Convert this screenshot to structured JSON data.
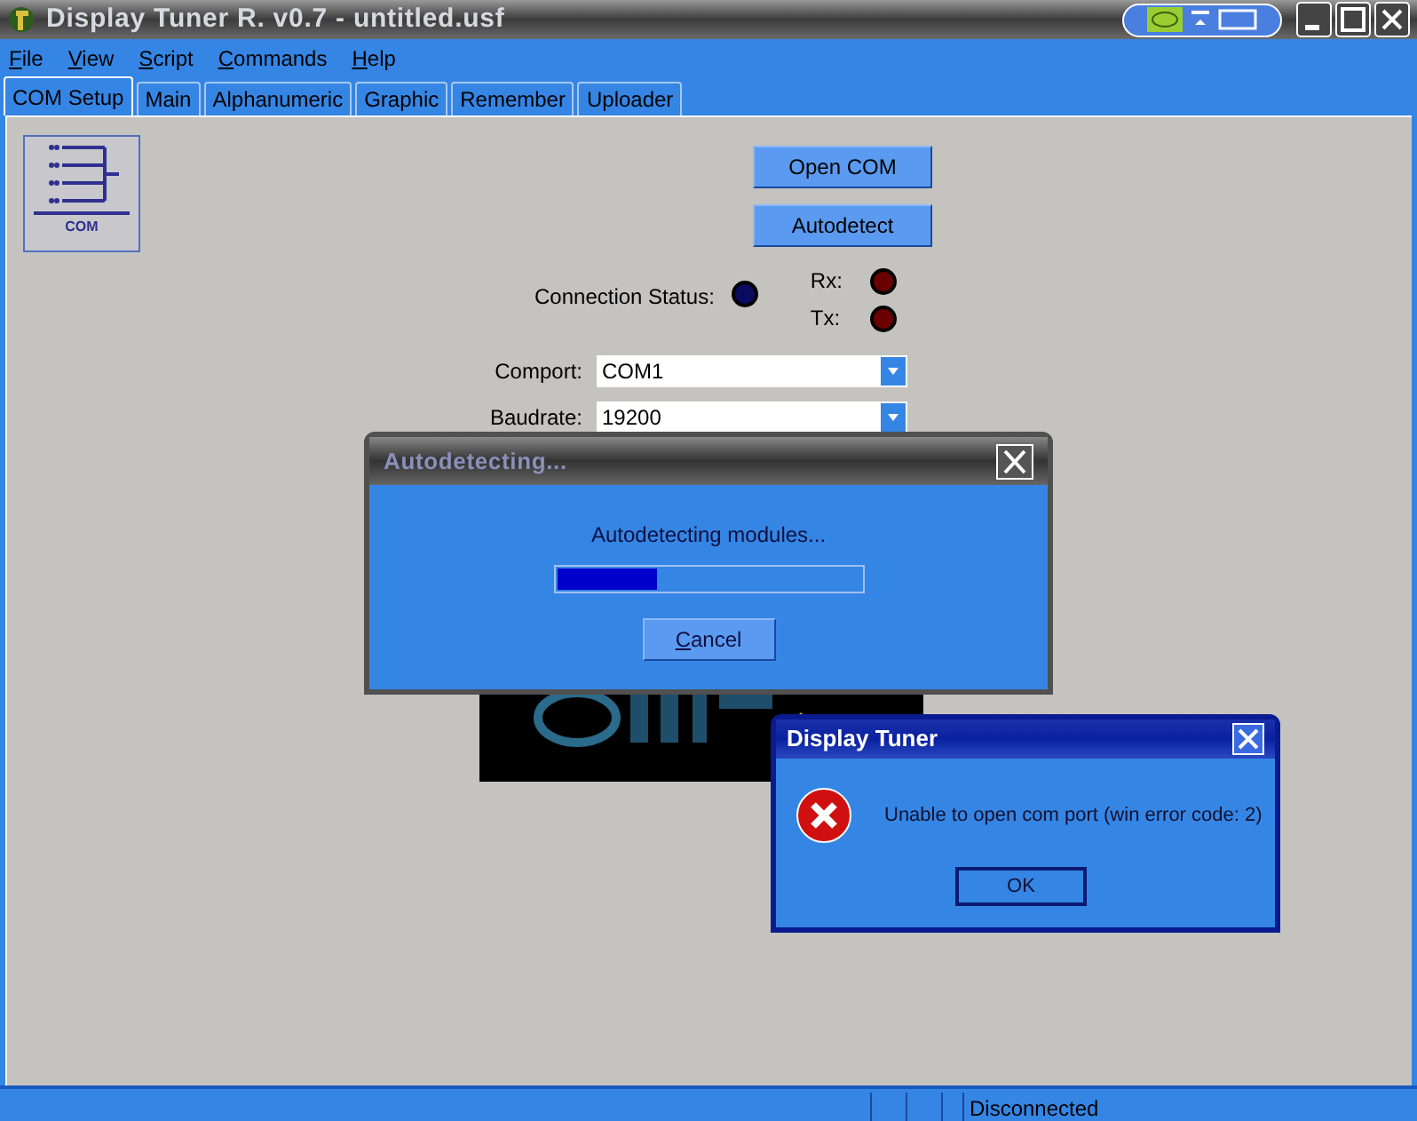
{
  "window": {
    "title": "Display Tuner R. v0.7 - untitled.usf"
  },
  "menu": [
    "File",
    "View",
    "Script",
    "Commands",
    "Help"
  ],
  "tabs": [
    {
      "label": "COM Setup",
      "selected": true
    },
    {
      "label": "Main",
      "selected": false
    },
    {
      "label": "Alphanumeric",
      "selected": false
    },
    {
      "label": "Graphic",
      "selected": false
    },
    {
      "label": "Remember",
      "selected": false
    },
    {
      "label": "Uploader",
      "selected": false
    }
  ],
  "com_icon": {
    "caption": "COM"
  },
  "buttons": [
    "Open COM",
    "Autodetect"
  ],
  "connection_status": {
    "label": "Connection Status:",
    "color": "#0a0a60"
  },
  "signals": [
    {
      "label": "Rx:",
      "color": "#6a0000"
    },
    {
      "label": "Tx:",
      "color": "#6a0000"
    }
  ],
  "fields": [
    {
      "label": "Comport:",
      "value": "COM1"
    },
    {
      "label": "Baudrate:",
      "value": "19200"
    }
  ],
  "progress_dialog": {
    "title": "Autodetecting...",
    "message": "Autodetecting modules...",
    "level": 0.33,
    "button": "Cancel"
  },
  "error_dialog": {
    "title": "Display Tuner",
    "message": "Unable to open com port (win error code: 2)",
    "button": "OK"
  },
  "status_bar": {
    "status": "Disconnected"
  }
}
